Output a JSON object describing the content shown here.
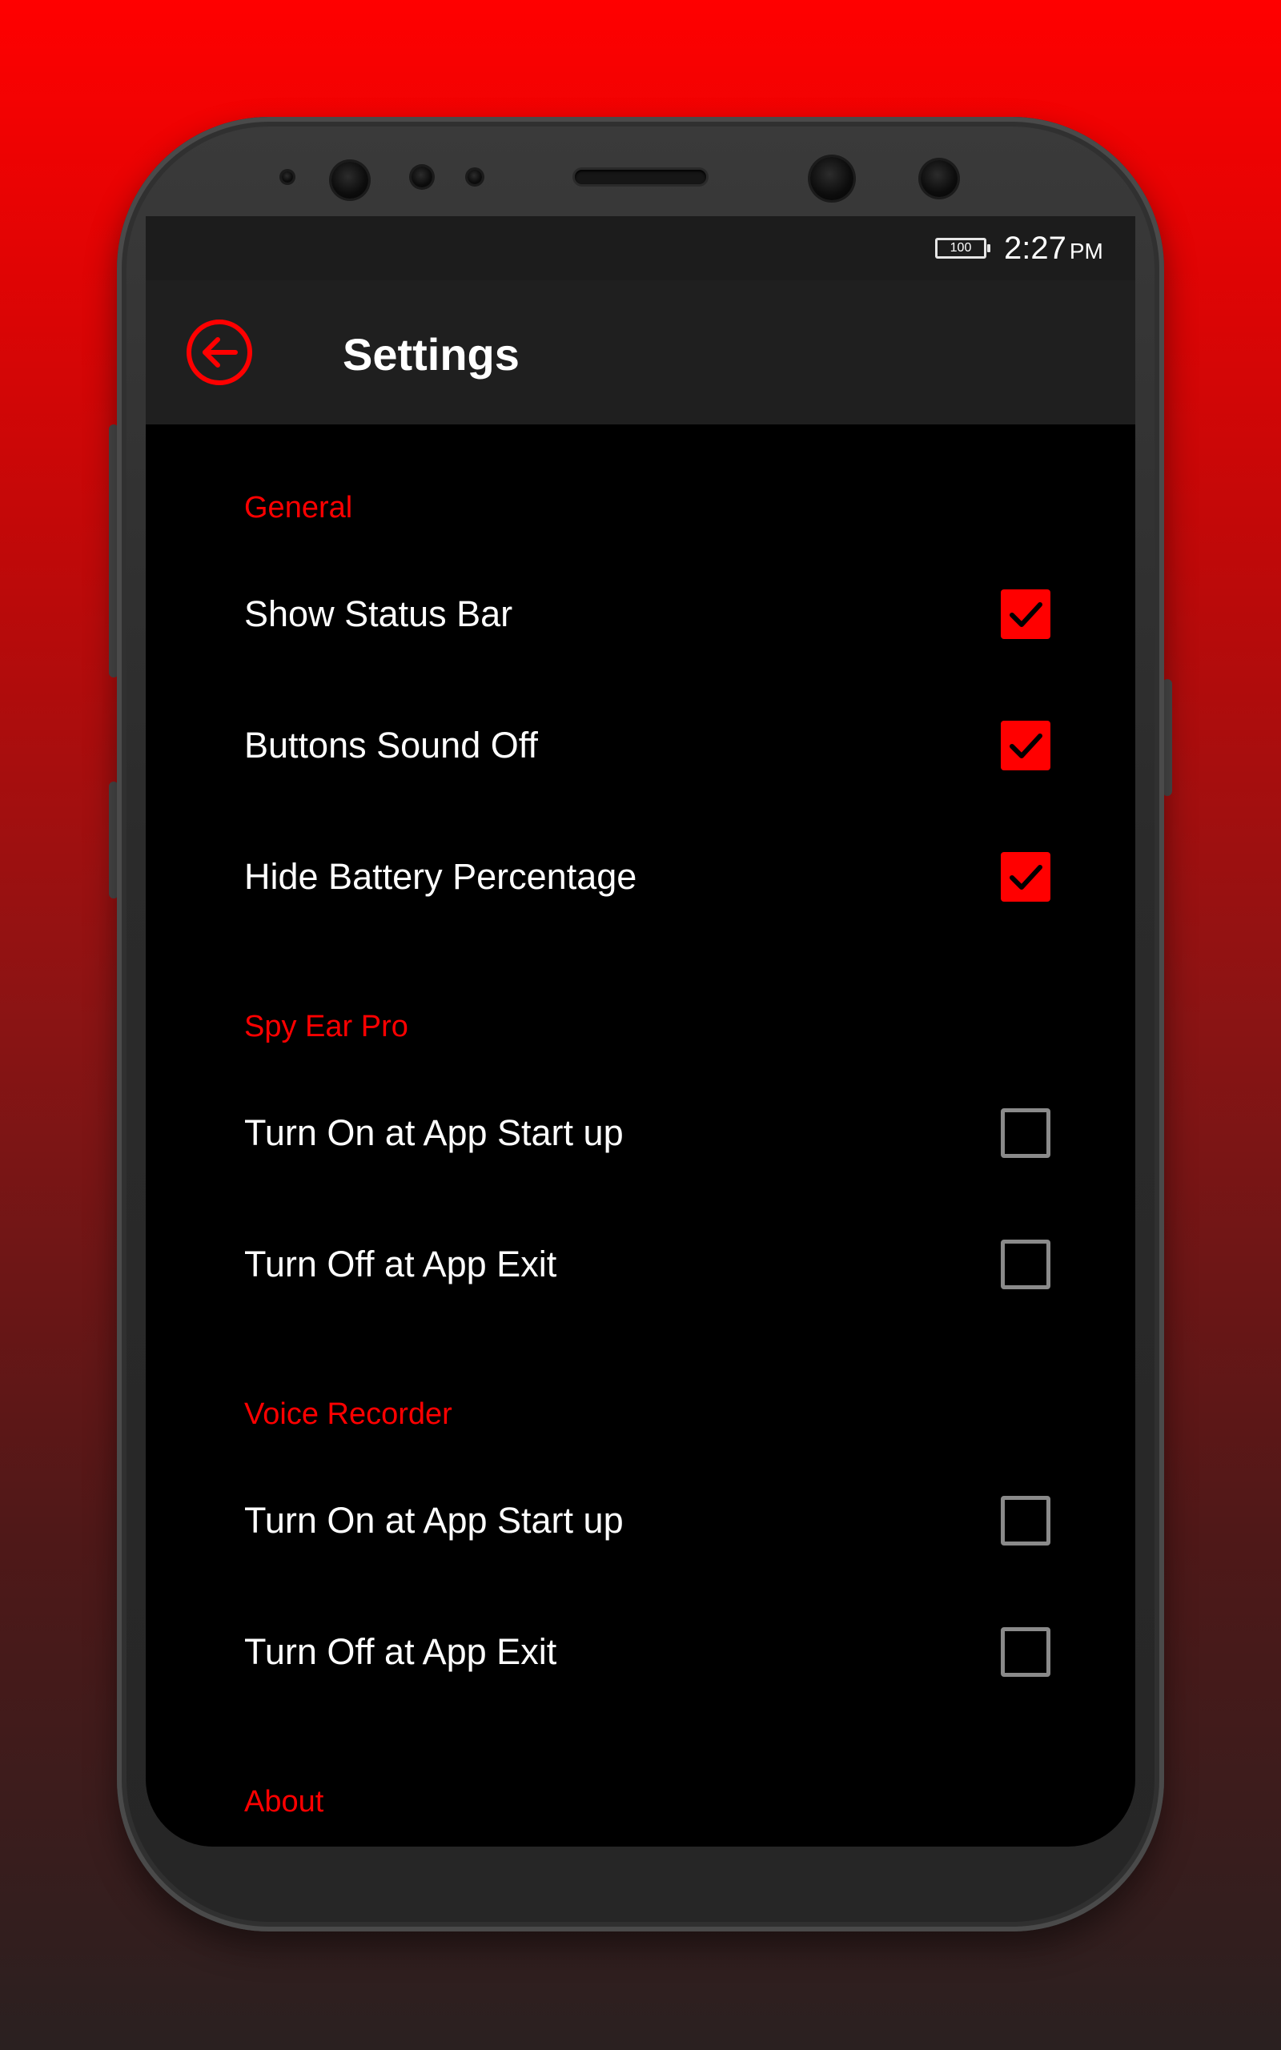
{
  "status_bar": {
    "battery_level": "100",
    "time": "2:27",
    "ampm": "PM"
  },
  "app_bar": {
    "title": "Settings",
    "back_icon": "arrow-left-circle-icon"
  },
  "colors": {
    "accent": "#ff0000",
    "background": "#000000",
    "app_bar": "#1f1f1f",
    "text": "#ffffff"
  },
  "sections": {
    "general": {
      "header": "General",
      "items": [
        {
          "label": "Show Status Bar",
          "checked": true
        },
        {
          "label": "Buttons Sound Off",
          "checked": true
        },
        {
          "label": "Hide Battery Percentage",
          "checked": true
        }
      ]
    },
    "spy_ear_pro": {
      "header": "Spy Ear Pro",
      "items": [
        {
          "label": "Turn On at App Start up",
          "checked": false
        },
        {
          "label": "Turn Off at App Exit",
          "checked": false
        }
      ]
    },
    "voice_recorder": {
      "header": "Voice Recorder",
      "items": [
        {
          "label": "Turn On at App Start up",
          "checked": false
        },
        {
          "label": "Turn Off at App Exit",
          "checked": false
        }
      ]
    },
    "about": {
      "header": "About"
    }
  }
}
